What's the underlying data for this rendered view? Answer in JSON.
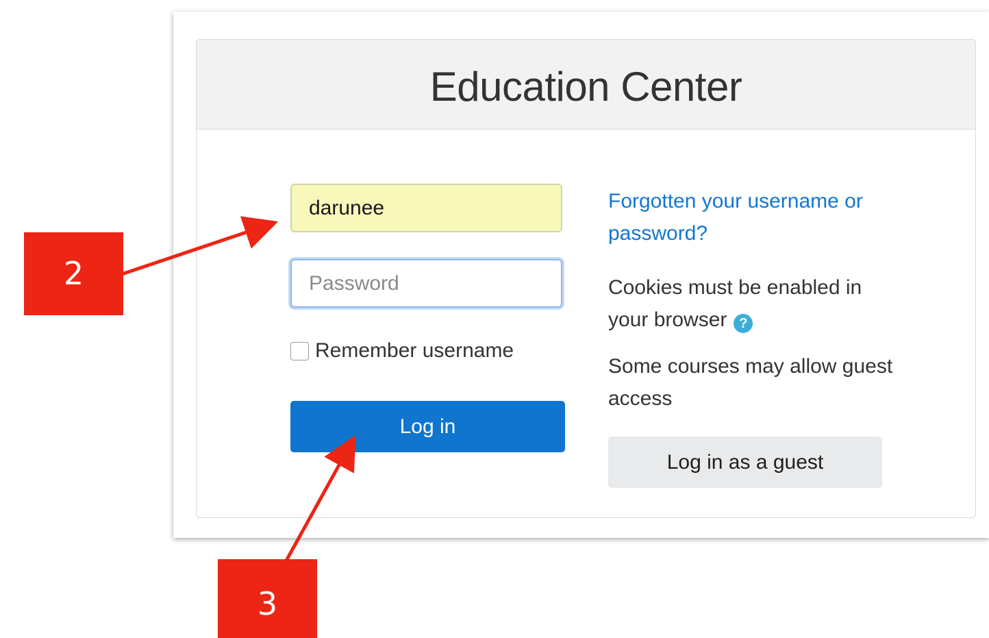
{
  "page": {
    "title": "Education Center"
  },
  "login_form": {
    "username_value": "darunee",
    "password_placeholder": "Password",
    "remember_label": "Remember username",
    "login_button_label": "Log in"
  },
  "info_panel": {
    "forgot_link": "Forgotten your username or password?",
    "cookies_text": "Cookies must be enabled in your browser",
    "help_icon_glyph": "?",
    "guest_text": "Some courses may allow guest access",
    "guest_button_label": "Log in as a guest"
  },
  "annotations": {
    "step_2": "2",
    "step_3": "3"
  },
  "colors": {
    "primary_button": "#0f75ce",
    "link": "#1177d1",
    "username_autofill_bg": "#f9f8bb",
    "annotation_red": "#ec2514",
    "help_icon": "#3aaed8"
  },
  "icons": {
    "help": "question-circle-icon",
    "annotation_arrow": "arrow-icon"
  }
}
